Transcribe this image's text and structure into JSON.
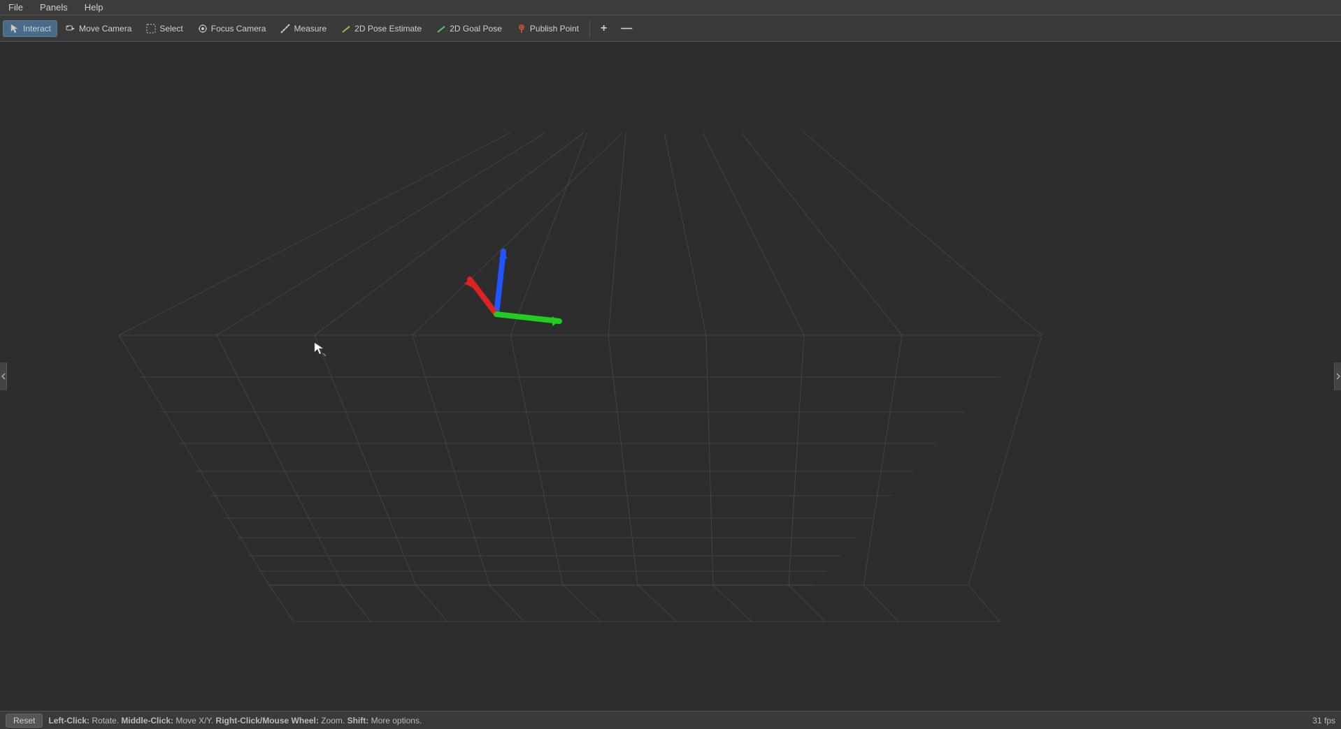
{
  "menu": {
    "items": [
      {
        "id": "file",
        "label": "File"
      },
      {
        "id": "panels",
        "label": "Panels"
      },
      {
        "id": "help",
        "label": "Help"
      }
    ]
  },
  "toolbar": {
    "tools": [
      {
        "id": "interact",
        "label": "Interact",
        "icon": "cursor",
        "active": true
      },
      {
        "id": "move-camera",
        "label": "Move Camera",
        "icon": "camera",
        "active": false
      },
      {
        "id": "select",
        "label": "Select",
        "icon": "select",
        "active": false
      },
      {
        "id": "focus-camera",
        "label": "Focus Camera",
        "icon": "focus",
        "active": false
      },
      {
        "id": "measure",
        "label": "Measure",
        "icon": "ruler",
        "active": false
      },
      {
        "id": "pose-estimate",
        "label": "2D Pose Estimate",
        "icon": "pose",
        "active": false
      },
      {
        "id": "goal-pose",
        "label": "2D Goal Pose",
        "icon": "goal",
        "active": false
      },
      {
        "id": "publish-point",
        "label": "Publish Point",
        "icon": "point",
        "active": false
      }
    ],
    "plus_icon": "+",
    "minus_icon": "—"
  },
  "statusbar": {
    "reset_label": "Reset",
    "status_text": "Left-Click: Rotate.  Middle-Click: Move X/Y.  Right-Click/Mouse Wheel: Zoom.  Shift: More options.",
    "fps": "31 fps"
  },
  "viewport": {
    "background_color": "#2d2d2d",
    "grid_color": "#555555"
  }
}
